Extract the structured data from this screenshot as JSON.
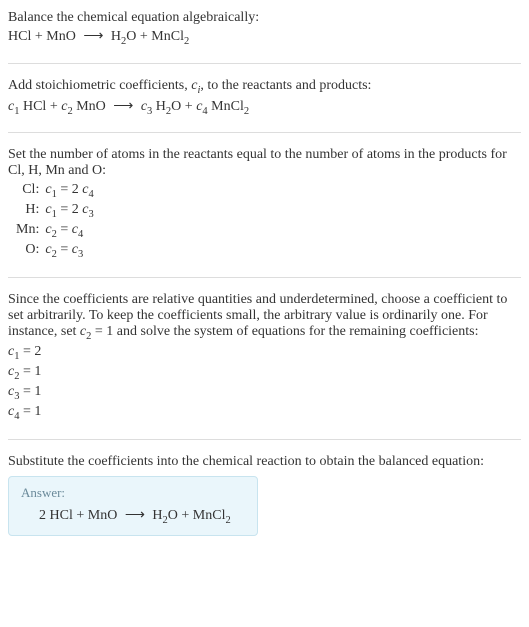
{
  "title": "Balance the chemical equation algebraically:",
  "eq1": {
    "lhs1": "HCl",
    "lhs2": "MnO",
    "rhs1": "H",
    "rhs1_sub": "2",
    "rhs1b": "O",
    "rhs2": "MnCl",
    "rhs2_sub": "2"
  },
  "step2_text": "Add stoichiometric coefficients, ",
  "step2_ci": "c",
  "step2_ci_sub": "i",
  "step2_text2": ", to the reactants and products:",
  "eq2": {
    "c1": "c",
    "c1_sub": "1",
    "sp1": " HCl",
    "c2": "c",
    "c2_sub": "2",
    "sp2": " MnO",
    "c3": "c",
    "c3_sub": "3",
    "sp3": " H",
    "sp3_sub": "2",
    "sp3b": "O",
    "c4": "c",
    "c4_sub": "4",
    "sp4": " MnCl",
    "sp4_sub": "2"
  },
  "step3_text": "Set the number of atoms in the reactants equal to the number of atoms in the products for Cl, H, Mn and O:",
  "atoms": [
    {
      "el": "Cl:",
      "lhs_c": "c",
      "lhs_sub": "1",
      "rhs_pre": "2 ",
      "rhs_c": "c",
      "rhs_sub": "4"
    },
    {
      "el": "H:",
      "lhs_c": "c",
      "lhs_sub": "1",
      "rhs_pre": "2 ",
      "rhs_c": "c",
      "rhs_sub": "3"
    },
    {
      "el": "Mn:",
      "lhs_c": "c",
      "lhs_sub": "2",
      "rhs_pre": "",
      "rhs_c": "c",
      "rhs_sub": "4"
    },
    {
      "el": "O:",
      "lhs_c": "c",
      "lhs_sub": "2",
      "rhs_pre": "",
      "rhs_c": "c",
      "rhs_sub": "3"
    }
  ],
  "step4_text": "Since the coefficients are relative quantities and underdetermined, choose a coefficient to set arbitrarily. To keep the coefficients small, the arbitrary value is ordinarily one. For instance, set ",
  "step4_c": "c",
  "step4_c_sub": "2",
  "step4_text2": " = 1 and solve the system of equations for the remaining coefficients:",
  "coefs": [
    {
      "c": "c",
      "sub": "1",
      "val": " = 2"
    },
    {
      "c": "c",
      "sub": "2",
      "val": " = 1"
    },
    {
      "c": "c",
      "sub": "3",
      "val": " = 1"
    },
    {
      "c": "c",
      "sub": "4",
      "val": " = 1"
    }
  ],
  "step5_text": "Substitute the coefficients into the chemical reaction to obtain the balanced equation:",
  "answer_label": "Answer:",
  "answer_eq": {
    "lhs1": "2 HCl",
    "lhs2": "MnO",
    "rhs1": "H",
    "rhs1_sub": "2",
    "rhs1b": "O",
    "rhs2": "MnCl",
    "rhs2_sub": "2"
  },
  "glyphs": {
    "plus": "+",
    "arrow": "⟶",
    "eq": "="
  }
}
